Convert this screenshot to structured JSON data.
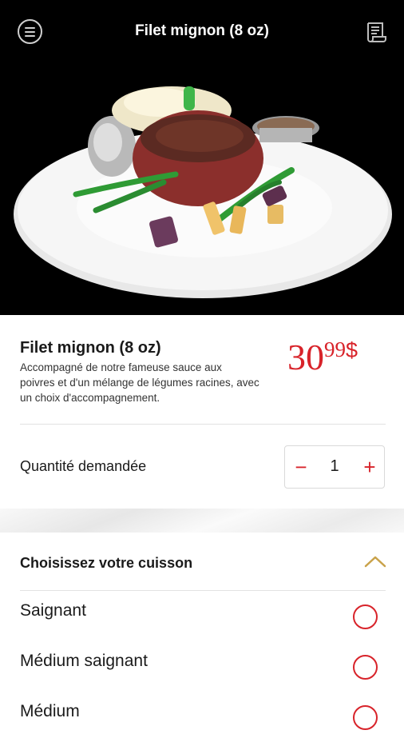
{
  "header": {
    "title": "Filet mignon (8 oz)",
    "menu_icon": "hamburger-menu-icon",
    "receipt_icon": "receipt-icon"
  },
  "hero": {
    "image": "filet-mignon-plate-photo"
  },
  "item": {
    "name": "Filet mignon (8 oz)",
    "description": "Accompagné de notre fameuse sauce aux poivres et d'un mélange de légumes racines, avec un choix d'accompagnement.",
    "price_main": "30",
    "price_cents": "99",
    "price_currency": "$"
  },
  "quantity": {
    "label": "Quantité demandée",
    "minus": "−",
    "value": "1",
    "plus": "+"
  },
  "cooking": {
    "title": "Choisissez votre cuisson",
    "options": [
      {
        "label": "Saignant"
      },
      {
        "label": "Médium saignant"
      },
      {
        "label": "Médium"
      }
    ]
  },
  "colors": {
    "accent": "#d8232a",
    "header_bg": "#000000",
    "chevron": "#c9a24a"
  }
}
